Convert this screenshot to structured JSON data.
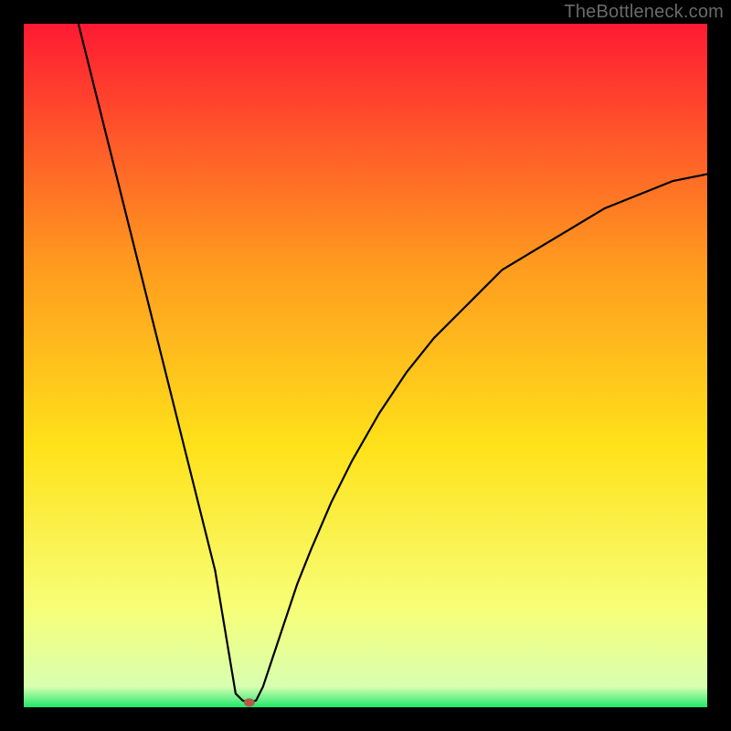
{
  "watermark": "TheBottleneck.com",
  "chart_data": {
    "type": "line",
    "title": "",
    "xlabel": "",
    "ylabel": "",
    "xlim": [
      0,
      100
    ],
    "ylim": [
      0,
      100
    ],
    "grid": false,
    "background_gradient": {
      "top_color": "#ff1a33",
      "mid_upper_color": "#ff9a1f",
      "mid_color": "#ffe21a",
      "lower_color": "#f6ff7a",
      "bottom_color": "#1fe86b"
    },
    "series": [
      {
        "name": "bottleneck-curve",
        "color": "#000000",
        "x": [
          8,
          10,
          12,
          14,
          16,
          18,
          20,
          22,
          24,
          26,
          28,
          30,
          31,
          32,
          33,
          34,
          35,
          36,
          38,
          40,
          42,
          45,
          48,
          52,
          56,
          60,
          65,
          70,
          75,
          80,
          85,
          90,
          95,
          100
        ],
        "y": [
          100,
          92,
          84,
          76,
          68,
          60,
          52,
          44,
          36,
          28,
          20,
          8,
          2,
          1,
          0.7,
          1,
          3,
          6,
          12,
          18,
          23,
          30,
          36,
          43,
          49,
          54,
          59,
          64,
          67,
          70,
          73,
          75,
          77,
          78
        ]
      }
    ],
    "marker": {
      "name": "optimum-point",
      "x": 33,
      "y": 0.7,
      "color": "#b55a4a",
      "rx": 6,
      "ry": 4.5
    }
  }
}
